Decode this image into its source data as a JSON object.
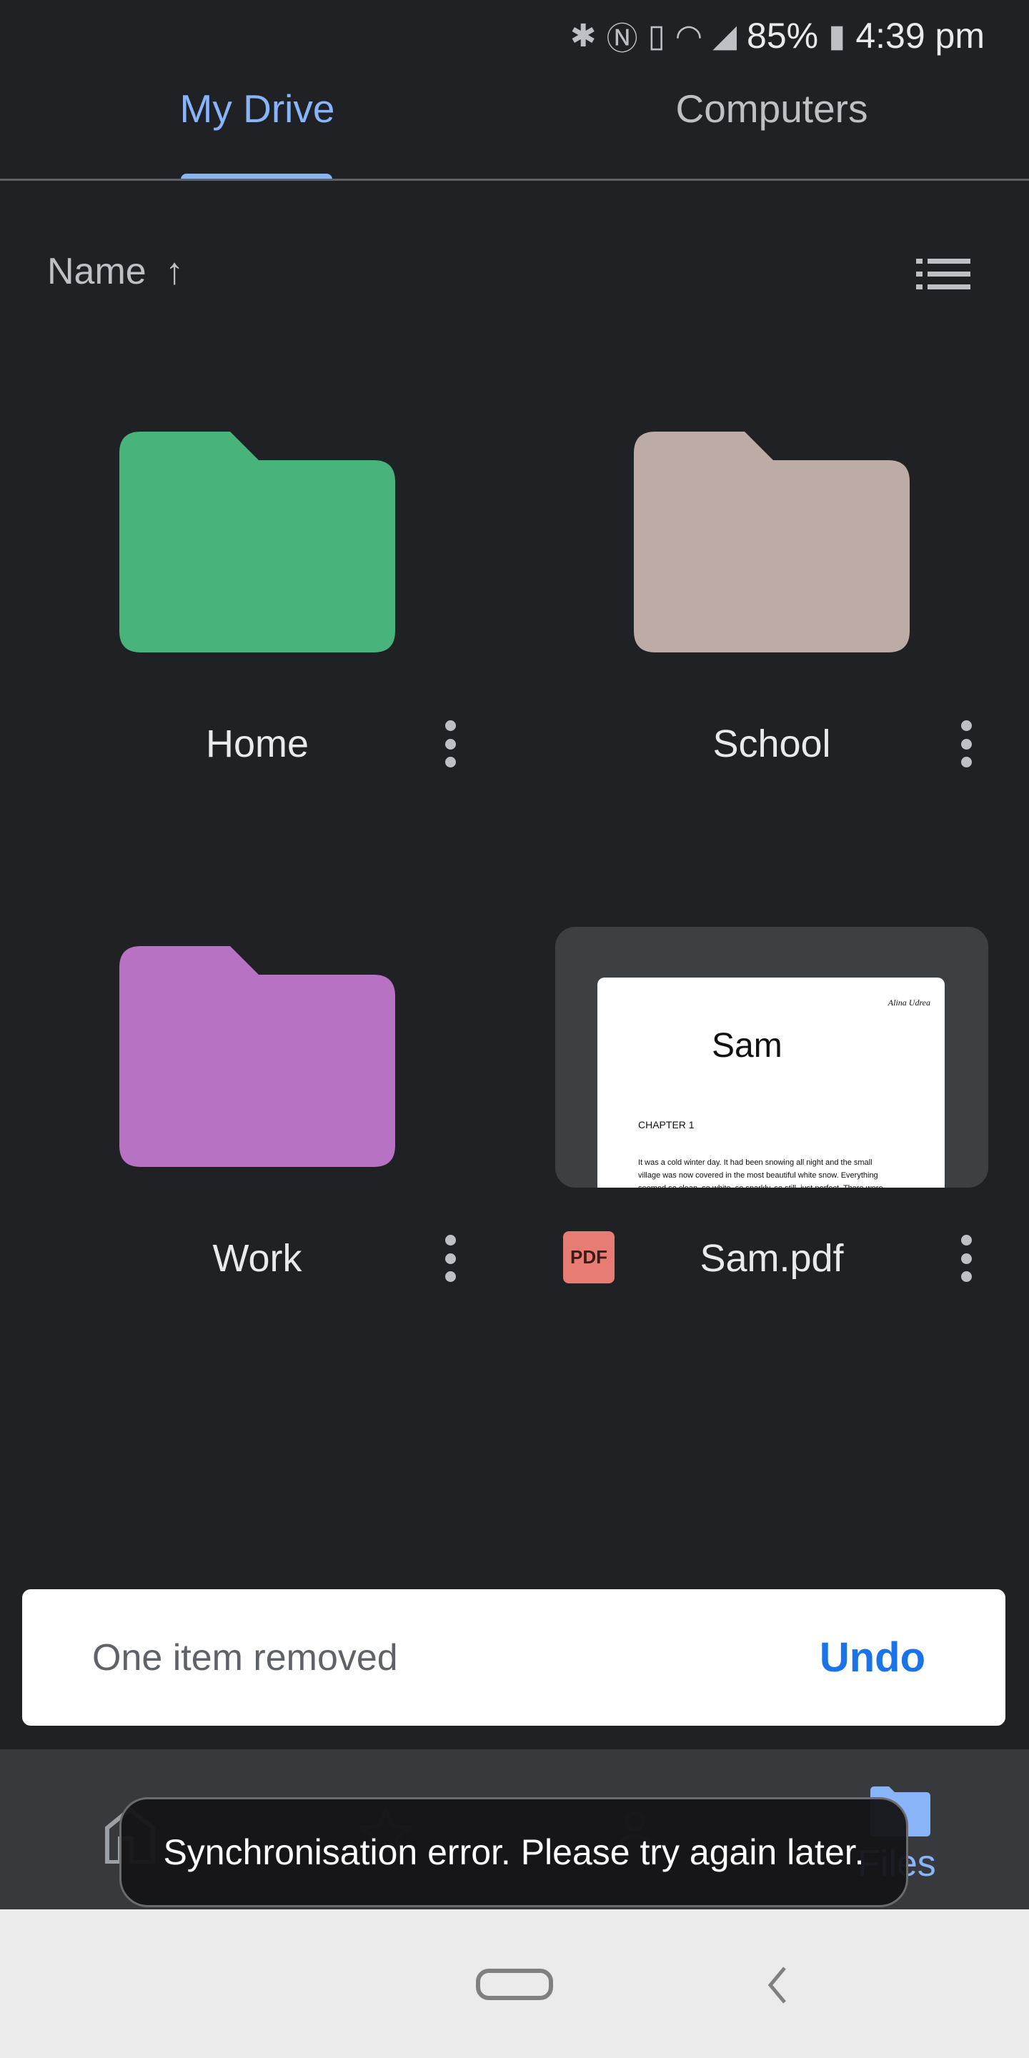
{
  "status_bar": {
    "battery": "85%",
    "time": "4:39 pm",
    "icons": [
      "bluetooth-icon",
      "nfc-icon",
      "vibrate-icon",
      "wifi-icon",
      "signal-icon",
      "battery-icon"
    ]
  },
  "tabs": [
    {
      "label": "My Drive",
      "active": true
    },
    {
      "label": "Computers",
      "active": false
    }
  ],
  "sort": {
    "label": "Name",
    "direction": "ascending"
  },
  "files": [
    {
      "name": "Home",
      "type": "folder",
      "color": "#48b37b"
    },
    {
      "name": "School",
      "type": "folder",
      "color": "#bcaca5"
    },
    {
      "name": "Work",
      "type": "folder",
      "color": "#b872c3"
    },
    {
      "name": "Sam.pdf",
      "type": "pdf",
      "badge": "PDF",
      "preview": {
        "author": "Alina Udrea",
        "title": "Sam",
        "chapter": "CHAPTER 1",
        "lines": [
          "It was a cold winter day. It had been snowing all night and the small",
          "village was now covered in the most beautiful white snow. Everything",
          "seemed so clean, so white, so sparkly, so still, just perfect. There were"
        ]
      }
    }
  ],
  "snackbar": {
    "message": "One item removed",
    "action": "Undo"
  },
  "bottom_nav": {
    "items": [
      "Home",
      "Starred",
      "Shared",
      "Files"
    ],
    "active": "Files"
  },
  "toast": {
    "message": "Synchronisation error. Please try again later."
  },
  "colors": {
    "accent": "#8ab4f8",
    "undo": "#1a73e8",
    "pdf": "#e67c73"
  }
}
